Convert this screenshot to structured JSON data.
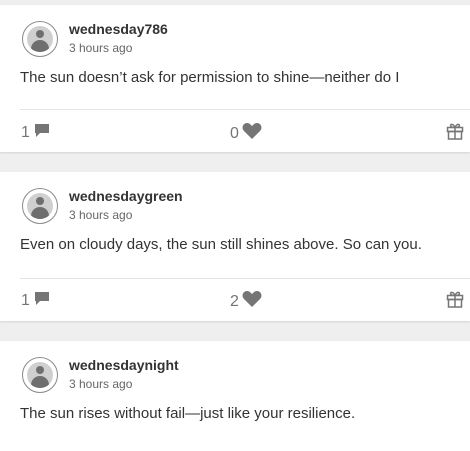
{
  "posts": [
    {
      "username": "wednesday786",
      "time": "3 hours ago",
      "content": "The sun doesn’t ask for permission to shine—neither do I",
      "comments": "1",
      "likes": "0"
    },
    {
      "username": "wednesdaygreen",
      "time": "3 hours ago",
      "content": "Even on cloudy days, the sun still shines above. So can you.",
      "comments": "1",
      "likes": "2"
    },
    {
      "username": "wednesdaynight",
      "time": "3 hours ago",
      "content": "The sun rises without fail—just like your resilience."
    }
  ],
  "icons": {
    "comment": "comment-icon",
    "like": "heart-icon",
    "gift": "gift-icon",
    "avatar": "user-avatar-icon"
  },
  "colors": {
    "background": "#efefef",
    "card": "#ffffff",
    "icon": "#757575"
  }
}
